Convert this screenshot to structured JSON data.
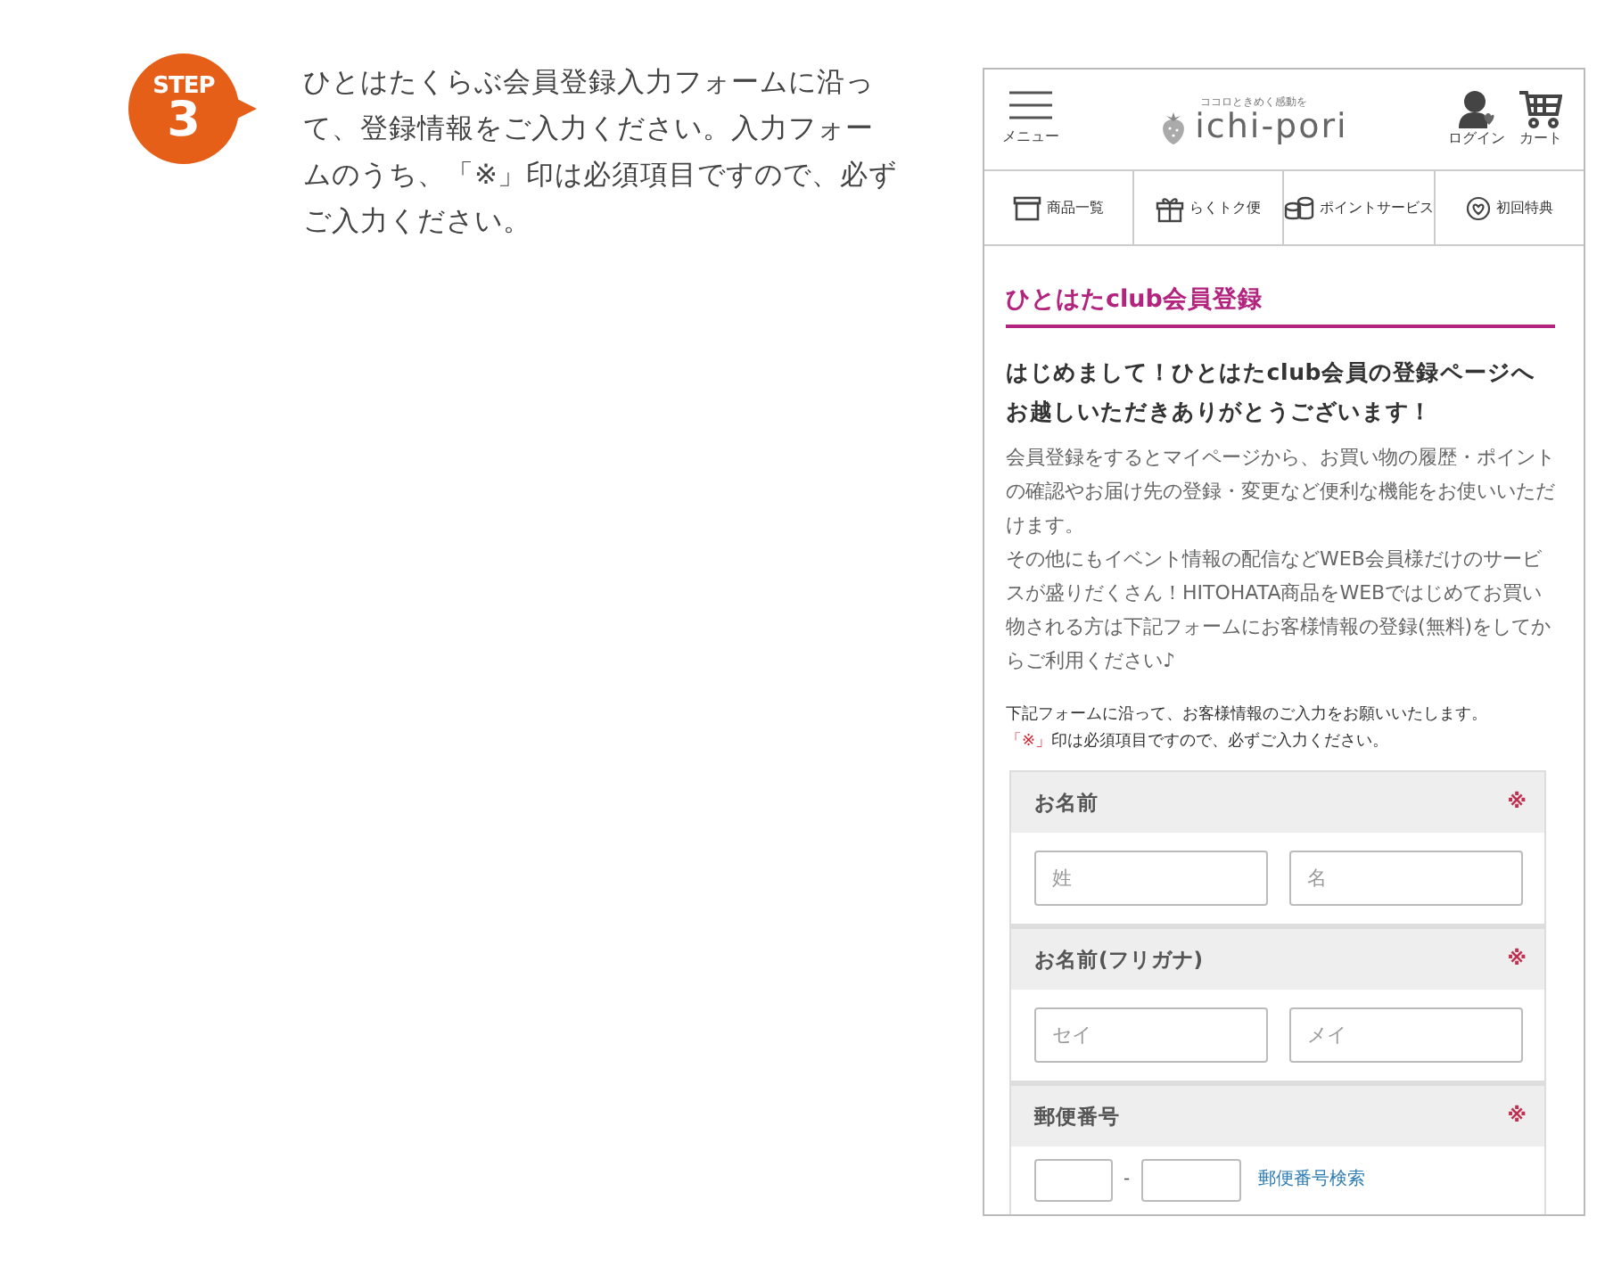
{
  "step": {
    "badge_label": "STEP",
    "number": "3",
    "text": "ひとはたくらぶ会員登録入力フォームに沿って、登録情報をご入力ください。入力フォームのうち、「※」印は必須項目ですので、必ずご入力ください。"
  },
  "phone": {
    "header": {
      "menu_label": "メニュー",
      "logo_tagline": "ココロときめく感動を",
      "logo_text": "ichi-pori",
      "buttons": [
        {
          "kind": "login",
          "label": "ログイン"
        },
        {
          "kind": "cart",
          "label": "カート"
        }
      ]
    },
    "nav": [
      {
        "kind": "box",
        "label": "商品一覧"
      },
      {
        "kind": "gift",
        "label": "らくトク便"
      },
      {
        "kind": "coins",
        "label": "ポイントサービス"
      },
      {
        "kind": "heart",
        "label": "初回特典"
      }
    ],
    "page_title": "ひとはたclub会員登録",
    "lead": "はじめまして！ひとはたclub会員の登録ページへお越しいただきありがとうございます！",
    "description": [
      "会員登録をするとマイページから、お買い物の履歴・ポイントの確認やお届け先の登録・変更など便利な機能をお使いいただけます。",
      "その他にもイベント情報の配信などWEB会員様だけのサービスが盛りだくさん！HITOHATA商品をWEBではじめてお買い物される方は下記フォームにお客様情報の登録(無料)をしてからご利用ください♪"
    ],
    "notes": [
      {
        "text": "下記フォームに沿って、お客様情報のご入力をお願いいたします。"
      },
      {
        "mark": "「※」",
        "text": "印は必須項目ですので、必ずご入力ください。"
      }
    ],
    "form": [
      {
        "kind": "pair",
        "label": "お名前",
        "required_mark": "※",
        "fields": [
          {
            "placeholder": "姓"
          },
          {
            "placeholder": "名"
          }
        ]
      },
      {
        "kind": "pair",
        "label": "お名前(フリガナ)",
        "required_mark": "※",
        "fields": [
          {
            "placeholder": "セイ"
          },
          {
            "placeholder": "メイ"
          }
        ]
      },
      {
        "kind": "postal",
        "label": "郵便番号",
        "required_mark": "※",
        "separator": "-",
        "link": "郵便番号検索"
      }
    ]
  }
}
